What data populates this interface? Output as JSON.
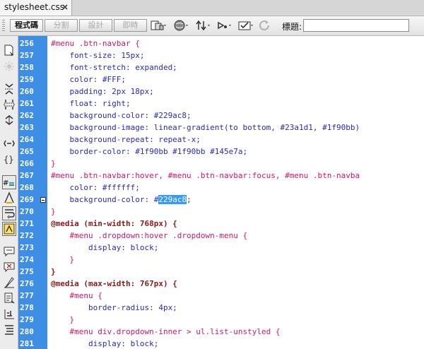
{
  "tab": {
    "label": "stylesheet.css"
  },
  "toolbar": {
    "views": [
      "程式碼",
      "分割",
      "設計",
      "即時"
    ],
    "active_view": "程式碼",
    "title_label": "標題:",
    "title_value": ""
  },
  "colors": {
    "gutter": "#3e8ee6",
    "selector": "#d4146b",
    "property": "#2828c8",
    "at_rule": "#8a1a1a",
    "selection": "#3399ff"
  },
  "editor": {
    "lines": [
      {
        "n": "256",
        "t": "#menu .btn-navbar {",
        "c": "sel"
      },
      {
        "n": "257",
        "t": "    font-size: 15px;",
        "c": "prop"
      },
      {
        "n": "258",
        "t": "    font-stretch: expanded;",
        "c": "prop"
      },
      {
        "n": "259",
        "t": "    color: #FFF;",
        "c": "prop"
      },
      {
        "n": "260",
        "t": "    padding: 2px 18px;",
        "c": "prop"
      },
      {
        "n": "261",
        "t": "    float: right;",
        "c": "prop"
      },
      {
        "n": "262",
        "t": "    background-color: #229ac8;",
        "c": "prop"
      },
      {
        "n": "263",
        "t": "    background-image: linear-gradient(to bottom, #23a1d1, #1f90bb)",
        "c": "prop"
      },
      {
        "n": "264",
        "t": "    background-repeat: repeat-x;",
        "c": "prop"
      },
      {
        "n": "265",
        "t": "    border-color: #1f90bb #1f90bb #145e7a;",
        "c": "prop"
      },
      {
        "n": "266",
        "t": "}",
        "c": "sel"
      },
      {
        "n": "267",
        "t": "#menu .btn-navbar:hover, #menu .btn-navbar:focus, #menu .btn-navba",
        "c": "sel"
      },
      {
        "n": "268",
        "t": "    color: #ffffff;",
        "c": "prop"
      },
      {
        "n": "269",
        "t": "    background-color: #",
        "hl": "229ac8",
        "after": ";",
        "c": "prop"
      },
      {
        "n": "270",
        "t": "}",
        "c": "sel"
      },
      {
        "n": "271",
        "t": "@media (min-width: 768px) {",
        "c": "at"
      },
      {
        "n": "272",
        "t": "    #menu .dropdown:hover .dropdown-menu {",
        "c": "sel"
      },
      {
        "n": "273",
        "t": "        display: block;",
        "c": "prop"
      },
      {
        "n": "274",
        "t": "    }",
        "c": "sel"
      },
      {
        "n": "275",
        "t": "}",
        "c": "at"
      },
      {
        "n": "276",
        "t": "@media (max-width: 767px) {",
        "c": "at"
      },
      {
        "n": "277",
        "t": "    #menu {",
        "c": "sel"
      },
      {
        "n": "278",
        "t": "        border-radius: 4px;",
        "c": "prop"
      },
      {
        "n": "279",
        "t": "    }",
        "c": "sel"
      },
      {
        "n": "280",
        "t": "    #menu div.dropdown-inner > ul.list-unstyled {",
        "c": "sel"
      },
      {
        "n": "281",
        "t": "        display: block;",
        "c": "prop"
      }
    ]
  }
}
